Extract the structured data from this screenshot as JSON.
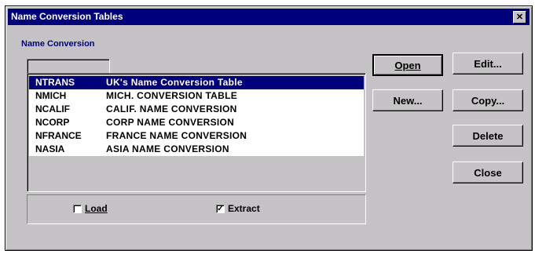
{
  "window": {
    "title": "Name Conversion Tables",
    "close_glyph": "✕"
  },
  "group": {
    "label": "Name Conversion"
  },
  "table": {
    "rows": [
      {
        "code": "NTRANS",
        "name": "UK's Name Conversion  Table",
        "selected": true
      },
      {
        "code": "NMICH",
        "name": "MICH. CONVERSION TABLE",
        "selected": false
      },
      {
        "code": "NCALIF",
        "name": "CALIF. NAME CONVERSION",
        "selected": false
      },
      {
        "code": "NCORP",
        "name": "CORP NAME CONVERSION",
        "selected": false
      },
      {
        "code": "NFRANCE",
        "name": "FRANCE NAME CONVERSION",
        "selected": false
      },
      {
        "code": "NASIA",
        "name": "ASIA NAME CONVERSION",
        "selected": false
      }
    ]
  },
  "options": {
    "load": {
      "label": "Load",
      "checked": false,
      "check_glyph": ""
    },
    "extract": {
      "label": "Extract",
      "checked": true,
      "check_glyph": "✓"
    }
  },
  "buttons": {
    "open": "Open",
    "new": "New...",
    "edit": "Edit...",
    "copy": "Copy...",
    "delete": "Delete",
    "close": "Close"
  },
  "colors": {
    "title_bar": "#00007b",
    "selection": "#00007b",
    "face": "#c6c3c6"
  }
}
